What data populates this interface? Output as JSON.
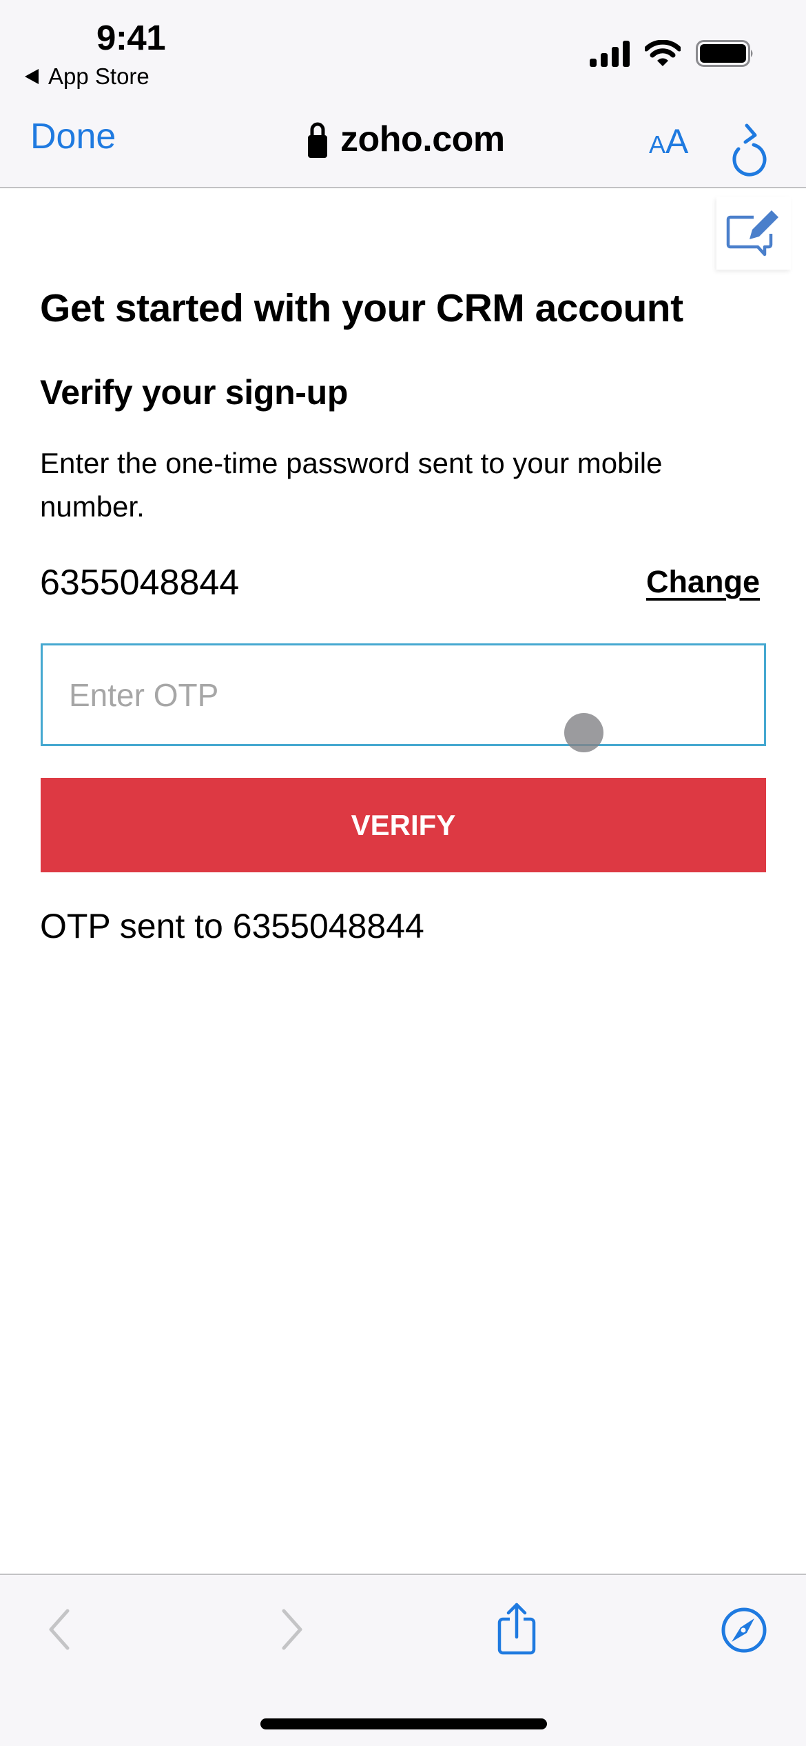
{
  "status_bar": {
    "time": "9:41",
    "back_app_label": "App Store",
    "icons": [
      "cellular-signal-icon",
      "wifi-icon",
      "battery-icon"
    ]
  },
  "browser": {
    "done_label": "Done",
    "domain": "zoho.com",
    "secure_icon": "lock-icon",
    "text_size_small": "A",
    "text_size_large": "A",
    "reload_icon": "reload-icon",
    "accent_color": "#1f7ae0"
  },
  "page": {
    "feedback_icon": "feedback-edit-icon",
    "title": "Get started with your CRM account",
    "section_title": "Verify your sign-up",
    "description": "Enter the one-time password sent to your mobile number.",
    "phone_number": "6355048844",
    "change_label": "Change",
    "otp_input": {
      "value": "",
      "placeholder": "Enter OTP"
    },
    "verify_label": "VERIFY",
    "verify_color": "#dd3943",
    "input_border_color": "#45a8d0",
    "otp_status": "OTP sent to 6355048844"
  },
  "toolbar": {
    "items": [
      {
        "name": "back",
        "icon": "chevron-left-icon",
        "enabled": false
      },
      {
        "name": "forward",
        "icon": "chevron-right-icon",
        "enabled": false
      },
      {
        "name": "share",
        "icon": "share-icon",
        "enabled": true
      },
      {
        "name": "open-in-safari",
        "icon": "compass-icon",
        "enabled": true
      }
    ]
  }
}
